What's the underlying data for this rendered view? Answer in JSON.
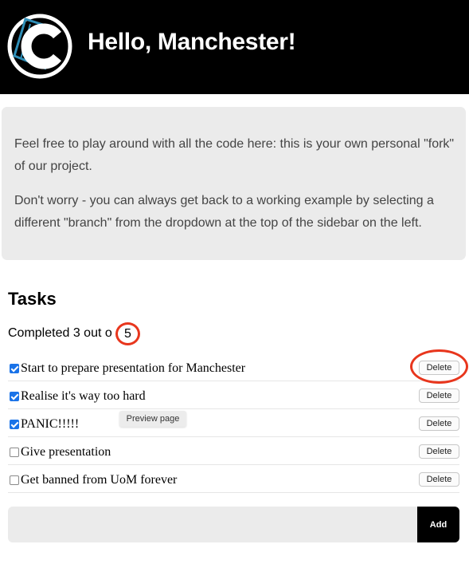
{
  "header": {
    "title": "Hello, Manchester!",
    "logo_icon": "c-logo-icon",
    "accent_color": "#2f8fb8"
  },
  "notice": {
    "paragraph1": "Feel free to play around with all the code here: this is your own personal \"fork\" of our project.",
    "paragraph2": "Don't worry - you can always get back to a working example by selecting a different \"branch\" from the dropdown at the top of the sidebar on the left."
  },
  "tasks": {
    "heading": "Tasks",
    "completed_prefix": "Completed 3 out o",
    "total": "5",
    "items": [
      {
        "text": "Start to prepare presentation for Manchester",
        "done": true,
        "delete_label": "Delete"
      },
      {
        "text": "Realise it's way too hard",
        "done": true,
        "delete_label": "Delete"
      },
      {
        "text": "PANIC!!!!!",
        "done": true,
        "delete_label": "Delete"
      },
      {
        "text": "Give presentation",
        "done": false,
        "delete_label": "Delete"
      },
      {
        "text": "Get banned from UoM forever",
        "done": false,
        "delete_label": "Delete"
      }
    ]
  },
  "tooltip": {
    "text": "Preview page"
  },
  "add_form": {
    "input_value": "",
    "button_label": "Add"
  },
  "annotation_color": "#e8361d"
}
